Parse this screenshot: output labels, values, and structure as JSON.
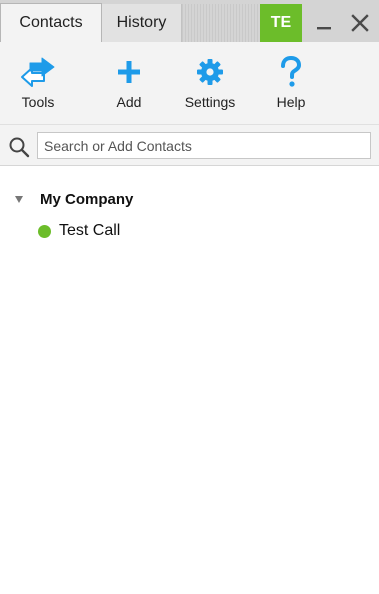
{
  "titlebar": {
    "tabs": [
      {
        "label": "Contacts",
        "active": true
      },
      {
        "label": "History",
        "active": false
      }
    ],
    "avatar_initials": "TE",
    "avatar_color": "#6cbd2a",
    "minimize_icon": "minimize-icon",
    "close_icon": "close-icon"
  },
  "toolbar": {
    "items": [
      {
        "label": "Tools",
        "icon": "tools-icon"
      },
      {
        "label": "Add",
        "icon": "plus-icon"
      },
      {
        "label": "Settings",
        "icon": "gear-icon"
      },
      {
        "label": "Help",
        "icon": "question-icon"
      }
    ],
    "accent_color": "#1e9be9"
  },
  "search": {
    "placeholder": "Search or Add Contacts",
    "value": ""
  },
  "contacts": {
    "groups": [
      {
        "name": "My Company",
        "expanded": true,
        "members": [
          {
            "name": "Test Call",
            "status_color": "#6cbd2a"
          }
        ]
      }
    ]
  }
}
